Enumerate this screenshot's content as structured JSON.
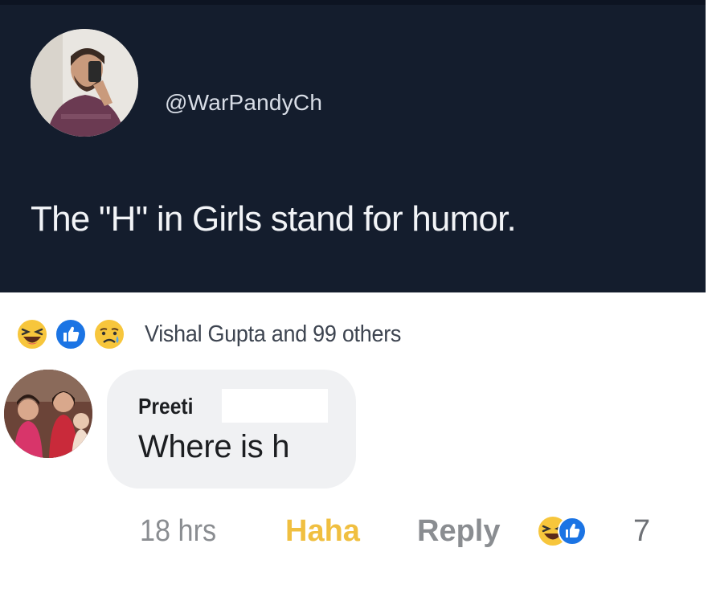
{
  "tweet": {
    "handle": "@WarPandyCh",
    "text": "The \"H\" in Girls stand for humor."
  },
  "post_reactions": {
    "icons": [
      "haha-icon",
      "like-icon",
      "sad-icon"
    ],
    "summary": "Vishal Gupta and 99 others"
  },
  "comment": {
    "author": "Preeti",
    "text": "Where is h",
    "time": "18 hrs",
    "haha_label": "Haha",
    "reply_label": "Reply",
    "reaction_icons": [
      "haha-icon",
      "like-icon"
    ],
    "reaction_count": "7"
  },
  "colors": {
    "tweet_bg": "#141d2d",
    "haha_active": "#f0bf40",
    "like_blue": "#1b74e4",
    "bubble_bg": "#f0f1f3"
  }
}
